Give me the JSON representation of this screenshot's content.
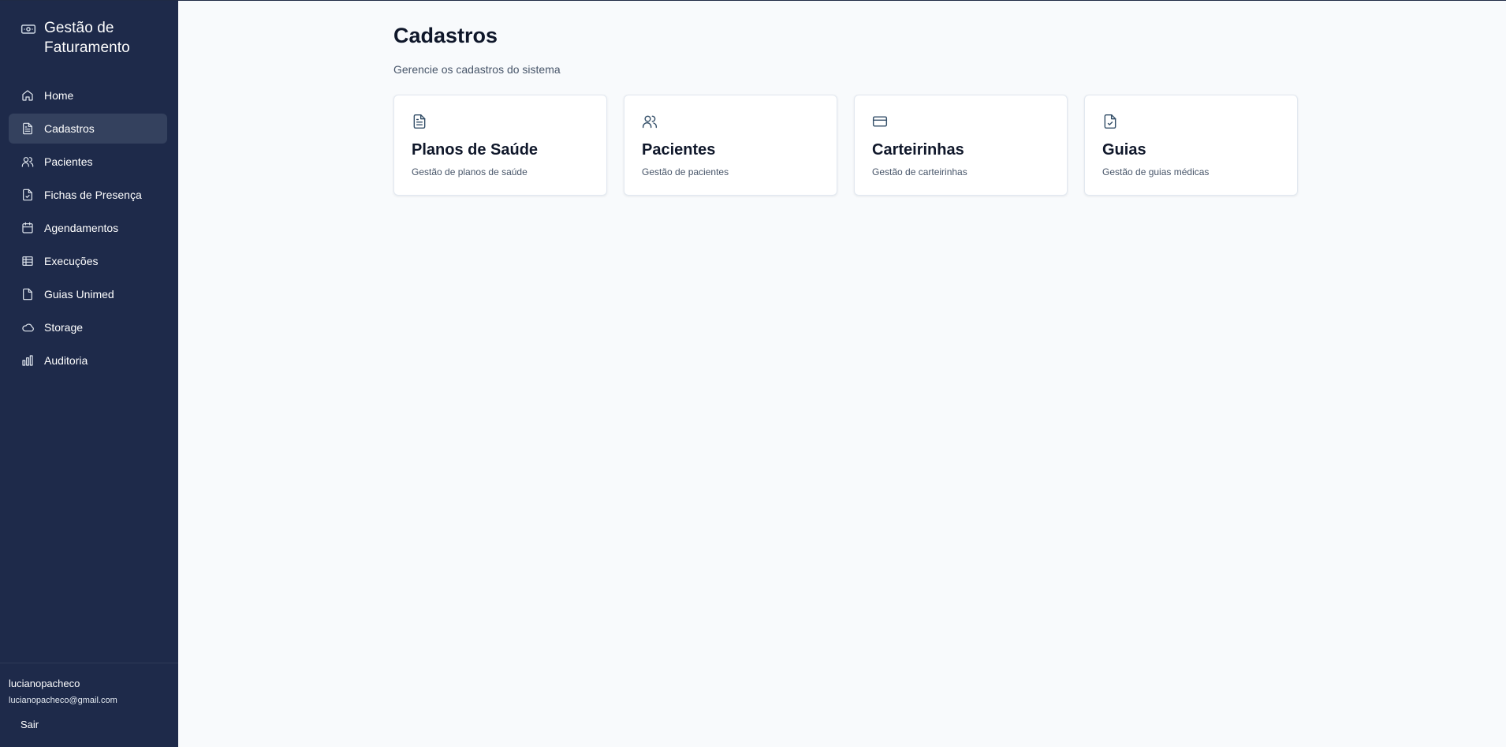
{
  "app": {
    "title": "Gestão de Faturamento",
    "icon": "banknote-icon"
  },
  "sidebar": {
    "items": [
      {
        "label": "Home",
        "icon": "home-icon",
        "active": false
      },
      {
        "label": "Cadastros",
        "icon": "file-text-icon",
        "active": true
      },
      {
        "label": "Pacientes",
        "icon": "users-icon",
        "active": false
      },
      {
        "label": "Fichas de Presença",
        "icon": "file-check-icon",
        "active": false
      },
      {
        "label": "Agendamentos",
        "icon": "calendar-icon",
        "active": false
      },
      {
        "label": "Execuções",
        "icon": "table-icon",
        "active": false
      },
      {
        "label": "Guias Unimed",
        "icon": "file-icon",
        "active": false
      },
      {
        "label": "Storage",
        "icon": "cloud-icon",
        "active": false
      },
      {
        "label": "Auditoria",
        "icon": "bar-chart-icon",
        "active": false
      }
    ]
  },
  "user": {
    "name": "lucianopacheco",
    "email": "lucianopacheco@gmail.com",
    "logout_label": "Sair"
  },
  "page": {
    "title": "Cadastros",
    "subtitle": "Gerencie os cadastros do sistema",
    "cards": [
      {
        "title": "Planos de Saúde",
        "description": "Gestão de planos de saúde",
        "icon": "file-text-icon"
      },
      {
        "title": "Pacientes",
        "description": "Gestão de pacientes",
        "icon": "users-icon"
      },
      {
        "title": "Carteirinhas",
        "description": "Gestão de carteirinhas",
        "icon": "credit-card-icon"
      },
      {
        "title": "Guias",
        "description": "Gestão de guias médicas",
        "icon": "file-check-icon"
      }
    ]
  },
  "colors": {
    "sidebar_bg": "#1e2a4a",
    "active_bg": "#34415e",
    "page_bg": "#f8fafc",
    "card_icon": "#334e68"
  }
}
